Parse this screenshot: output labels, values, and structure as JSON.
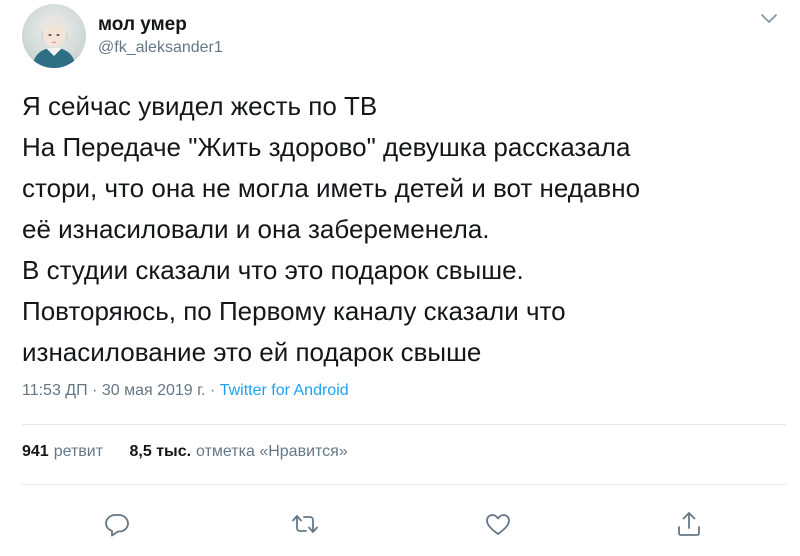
{
  "author": {
    "display_name": "мол умер",
    "handle": "@fk_aleksander1"
  },
  "tweet": {
    "lines": [
      "Я сейчас увидел жесть по ТВ",
      "На Передаче \"Жить здорово\" девушка рассказала",
      "стори, что она не могла иметь детей и вот недавно",
      "её изнасиловали и она забеременела.",
      "В студии сказали что это подарок свыше.",
      "Повторяюсь, по Первому каналу сказали что",
      "изнасилование это ей подарок свыше"
    ]
  },
  "meta": {
    "time": "11:53 ДП",
    "separator": " · ",
    "date": "30 мая 2019 г.",
    "source": "Twitter for Android"
  },
  "stats": {
    "retweets_count": "941",
    "retweets_label": "ретвит",
    "likes_count": "8,5 тыс.",
    "likes_label": "отметка «Нравится»"
  },
  "icons": {
    "menu": "chevron-down-icon",
    "reply": "reply-icon",
    "retweet": "retweet-icon",
    "like": "heart-icon",
    "share": "share-icon"
  },
  "colors": {
    "text": "#14171a",
    "secondary": "#657786",
    "link": "#1da1f2",
    "divider": "#e1e8ed"
  }
}
